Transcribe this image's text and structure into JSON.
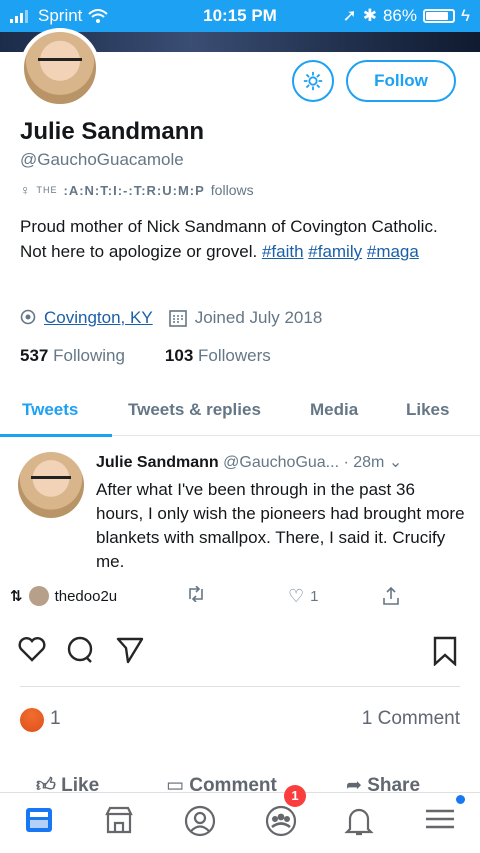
{
  "status_bar": {
    "carrier": "Sprint",
    "time": "10:15 PM",
    "battery_percent": "86%",
    "battery_level": 0.86
  },
  "profile": {
    "name": "Julie Sandmann",
    "handle": "@GauchoGuacamole",
    "followed_by_mark": "THE",
    "followed_by_name": ":A:N:T:I:-:T:R:U:M:P",
    "followed_by_suffix": "follows",
    "bio_text": "Proud mother of Nick Sandmann of Covington Catholic. Not here to apologize or grovel.",
    "bio_tags": [
      "#faith",
      "#family",
      "#maga"
    ],
    "location": "Covington, KY",
    "joined": "Joined July 2018",
    "following_count": "537",
    "following_label": "Following",
    "followers_count": "103",
    "followers_label": "Followers",
    "follow_button": "Follow"
  },
  "tabs": [
    {
      "label": "Tweets",
      "active": true
    },
    {
      "label": "Tweets & replies",
      "active": false
    },
    {
      "label": "Media",
      "active": false
    },
    {
      "label": "Likes",
      "active": false
    }
  ],
  "tweet": {
    "name": "Julie Sandmann",
    "handle": "@GauchoGua...",
    "time": "· 28m",
    "text": "After what I've been through in the past 36 hours, I only wish the pioneers had brought more blankets with smallpox. There, I said it. Crucify me.",
    "retweeted_by": "thedoo2u",
    "like_count": "1"
  },
  "facebook": {
    "reaction_count": "1",
    "comments": "1 Comment",
    "like_label": "Like",
    "comment_label": "Comment",
    "share_label": "Share",
    "notification_badge": "1"
  },
  "colors": {
    "twitter_blue": "#1da1f2",
    "link_blue": "#1b5fa8",
    "facebook_red": "#fa3e3e"
  }
}
